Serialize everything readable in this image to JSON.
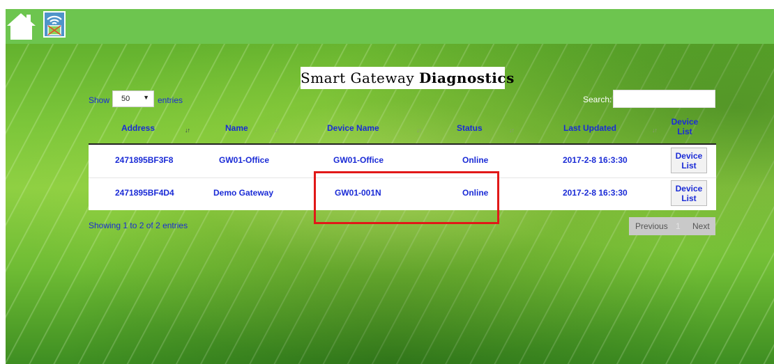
{
  "title": {
    "part1": "Smart Gateway",
    "part2": "Diagnostics"
  },
  "controls": {
    "show_label": "Show",
    "page_size": "50",
    "entries_label": "entries",
    "search_label": "Search:",
    "search_value": ""
  },
  "table": {
    "headers": {
      "address": "Address",
      "name": "Name",
      "device_name": "Device Name",
      "status": "Status",
      "last_updated": "Last Updated",
      "device_list_1": "Device",
      "device_list_2": "List"
    },
    "rows": [
      {
        "address": "2471895BF3F8",
        "name": "GW01-Office",
        "device_name": "GW01-Office",
        "status": "Online",
        "last_updated": "2017-2-8 16:3:30",
        "btn_1": "Device",
        "btn_2": "List"
      },
      {
        "address": "2471895BF4D4",
        "name": "Demo Gateway",
        "device_name": "GW01-001N",
        "status": "Online",
        "last_updated": "2017-2-8 16:3:30",
        "btn_1": "Device",
        "btn_2": "List"
      }
    ]
  },
  "footer": {
    "info": "Showing 1 to 2 of 2 entries",
    "previous": "Previous",
    "page": "1",
    "next": "Next"
  },
  "icons": {
    "home": "home-icon",
    "gateway": "wifi-gateway-icon",
    "sort": "sort-icon"
  },
  "colors": {
    "topbar": "#6dc54f",
    "link": "#1a2bd6",
    "highlight": "#e11818",
    "gateway_tile": "#4f94c9"
  }
}
